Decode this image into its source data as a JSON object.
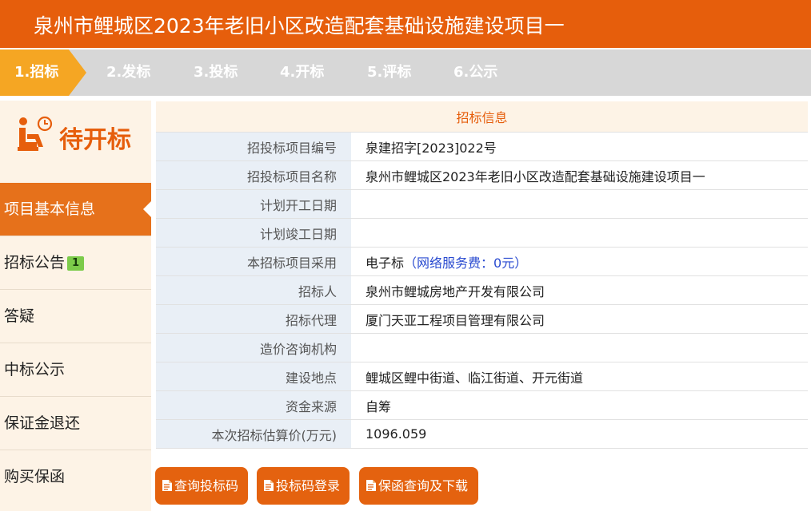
{
  "header": {
    "title": "泉州市鲤城区2023年老旧小区改造配套基础设施建设项目一"
  },
  "steps": [
    "1.招标",
    "2.发标",
    "3.投标",
    "4.开标",
    "5.评标",
    "6.公示"
  ],
  "status": {
    "label": "待开标"
  },
  "sidebar": {
    "items": [
      {
        "label": "项目基本信息"
      },
      {
        "label": "招标公告",
        "badge": "1"
      },
      {
        "label": "答疑"
      },
      {
        "label": "中标公示"
      },
      {
        "label": "保证金退还"
      },
      {
        "label": "购买保函"
      }
    ]
  },
  "info": {
    "caption": "招标信息",
    "rows": [
      {
        "label": "招投标项目编号",
        "value": "泉建招字[2023]022号"
      },
      {
        "label": "招投标项目名称",
        "value": "泉州市鲤城区2023年老旧小区改造配套基础设施建设项目一"
      },
      {
        "label": "计划开工日期",
        "value": ""
      },
      {
        "label": "计划竣工日期",
        "value": ""
      },
      {
        "label": "本招标项目采用",
        "value": "电子标",
        "note": "（网络服务费：0元）"
      },
      {
        "label": "招标人",
        "value": "泉州市鲤城房地产开发有限公司"
      },
      {
        "label": "招标代理",
        "value": "厦门天亚工程项目管理有限公司"
      },
      {
        "label": "造价咨询机构",
        "value": ""
      },
      {
        "label": "建设地点",
        "value": "鲤城区鲤中街道、临江街道、开元街道"
      },
      {
        "label": "资金来源",
        "value": "自筹"
      },
      {
        "label": "本次招标估算价(万元)",
        "value": "1096.059"
      }
    ]
  },
  "buttons": {
    "query_code": "查询投标码",
    "code_login": "投标码登录",
    "guarantee": "保函查询及下载"
  },
  "colors": {
    "brand": "#e65e0c",
    "step_active": "#f5a623",
    "badge": "#7ccb4a"
  }
}
